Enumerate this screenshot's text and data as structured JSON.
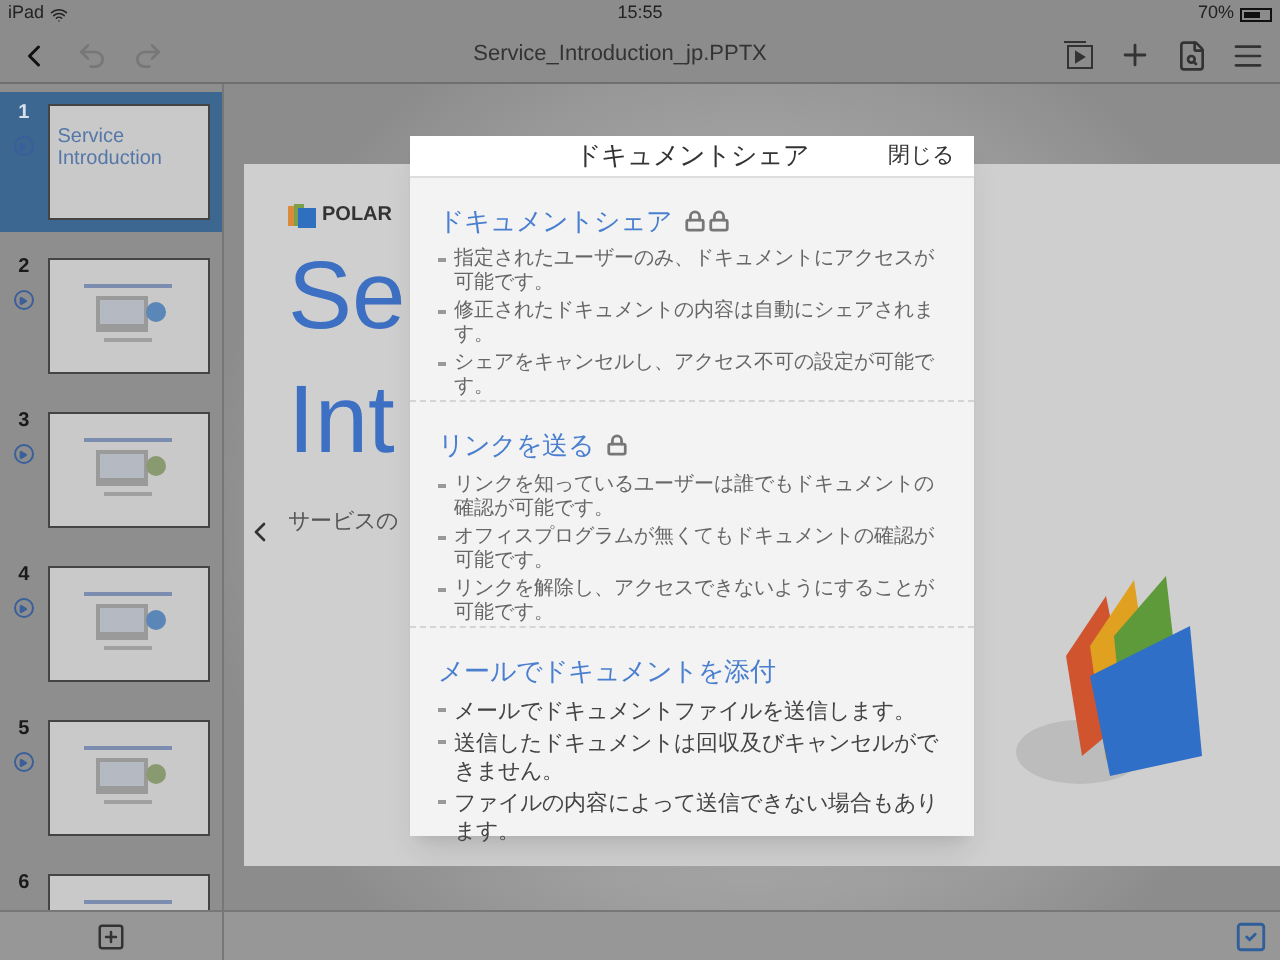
{
  "status_bar": {
    "device": "iPad",
    "time": "15:55",
    "battery": "70%"
  },
  "toolbar": {
    "title": "Service_Introduction_jp.PPTX"
  },
  "slides": [
    {
      "number": "1",
      "selected": true,
      "title": "Service Introduction",
      "animated": true
    },
    {
      "number": "2",
      "selected": false,
      "animated": true
    },
    {
      "number": "3",
      "selected": false,
      "animated": true
    },
    {
      "number": "4",
      "selected": false,
      "animated": true
    },
    {
      "number": "5",
      "selected": false,
      "animated": true
    },
    {
      "number": "6",
      "selected": false
    }
  ],
  "slide": {
    "logo": "POLAR",
    "title_lines": [
      "Se",
      "Int"
    ],
    "subtitle": "サービスの"
  },
  "dialog": {
    "title": "ドキュメントシェア",
    "close": "閉じる",
    "options": [
      {
        "title": "ドキュメントシェア",
        "locked": true,
        "double_lock": true,
        "kind": "small",
        "bullets": [
          "指定されたユーザーのみ、ドキュメントにアクセスが可能です。",
          "修正されたドキュメントの内容は自動にシェアされます。",
          "シェアをキャンセルし、アクセス不可の設定が可能です。"
        ]
      },
      {
        "title": "リンクを送る",
        "locked": true,
        "double_lock": false,
        "kind": "small",
        "bullets": [
          "リンクを知っているユーザーは誰でもドキュメントの確認が可能です。",
          "オフィスプログラムが無くてもドキュメントの確認が可能です。",
          "リンクを解除し、アクセスできないようにすることが可能です。"
        ]
      },
      {
        "title": "メールでドキュメントを添付",
        "locked": false,
        "kind": "large",
        "bullets": [
          "メールでドキュメントファイルを送信します。",
          "送信したドキュメントは回収及びキャンセルができません。",
          "ファイルの内容によって送信できない場合もあります。"
        ]
      }
    ]
  }
}
